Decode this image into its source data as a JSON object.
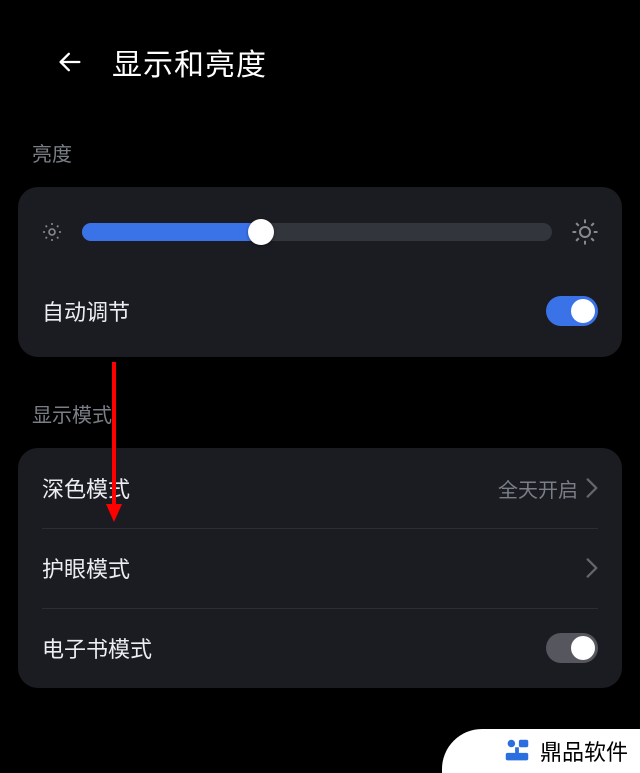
{
  "header": {
    "title": "显示和亮度"
  },
  "brightness": {
    "section_label": "亮度",
    "slider_percent": 38,
    "auto_label": "自动调节",
    "auto_on": true
  },
  "display_mode": {
    "section_label": "显示模式",
    "dark_mode": {
      "label": "深色模式",
      "value": "全天开启"
    },
    "eye_care": {
      "label": "护眼模式"
    },
    "ebook": {
      "label": "电子书模式",
      "on": false
    }
  },
  "watermark": {
    "text": "鼎品软件"
  },
  "colors": {
    "accent": "#3a73e8",
    "annotation": "#ff0000"
  }
}
